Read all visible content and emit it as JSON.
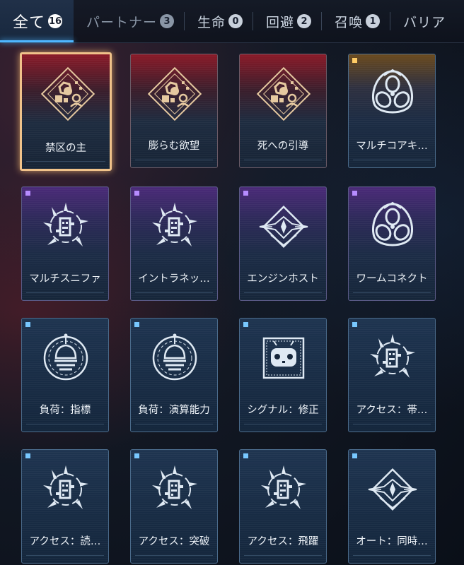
{
  "tabs": [
    {
      "label": "全て",
      "count": "16",
      "active": true
    },
    {
      "label": "パートナー",
      "count": "3",
      "active": false
    },
    {
      "label": "生命",
      "count": "0",
      "active": false
    },
    {
      "label": "回避",
      "count": "2",
      "active": false
    },
    {
      "label": "召喚",
      "count": "1",
      "active": false
    },
    {
      "label": "バリア",
      "count": "",
      "active": false
    }
  ],
  "cards": [
    {
      "name": "禁区の主",
      "icon": "hex-network-emblem-icon",
      "rarity": "red",
      "selected": true
    },
    {
      "name": "膨らむ欲望",
      "icon": "hex-network-emblem-icon",
      "rarity": "red",
      "selected": false
    },
    {
      "name": "死への引導",
      "icon": "hex-network-emblem-icon",
      "rarity": "red",
      "selected": false
    },
    {
      "name": "マルチコアキ…",
      "icon": "triple-core-icon",
      "rarity": "gold",
      "selected": false
    },
    {
      "name": "マルチスニファ",
      "icon": "spiked-bug-icon",
      "rarity": "purple",
      "selected": false
    },
    {
      "name": "イントラネッ…",
      "icon": "spiked-bug-icon",
      "rarity": "purple",
      "selected": false
    },
    {
      "name": "エンジンホスト",
      "icon": "winged-crest-icon",
      "rarity": "purple",
      "selected": false
    },
    {
      "name": "ワームコネクト",
      "icon": "triple-core-icon",
      "rarity": "purple",
      "selected": false
    },
    {
      "name": "負荷：指標",
      "icon": "dome-meter-icon",
      "rarity": "blue",
      "selected": false
    },
    {
      "name": "負荷：演算能力",
      "icon": "dome-meter-icon",
      "rarity": "blue",
      "selected": false
    },
    {
      "name": "シグナル：修正",
      "icon": "robot-face-icon",
      "rarity": "blue",
      "selected": false
    },
    {
      "name": "アクセス：帯…",
      "icon": "spiked-bug-icon",
      "rarity": "blue",
      "selected": false
    },
    {
      "name": "アクセス：読…",
      "icon": "spiked-bug-icon",
      "rarity": "blue",
      "selected": false
    },
    {
      "name": "アクセス：突破",
      "icon": "spiked-bug-icon",
      "rarity": "blue",
      "selected": false
    },
    {
      "name": "アクセス：飛躍",
      "icon": "spiked-bug-icon",
      "rarity": "blue",
      "selected": false
    },
    {
      "name": "オート：同時…",
      "icon": "winged-crest-icon",
      "rarity": "blue",
      "selected": false
    }
  ],
  "colors": {
    "accent": "#4fb6ff",
    "selected_border": "#f0c28a",
    "icon_gold": "#e6c9a0",
    "icon_white": "#dfe9f3"
  }
}
